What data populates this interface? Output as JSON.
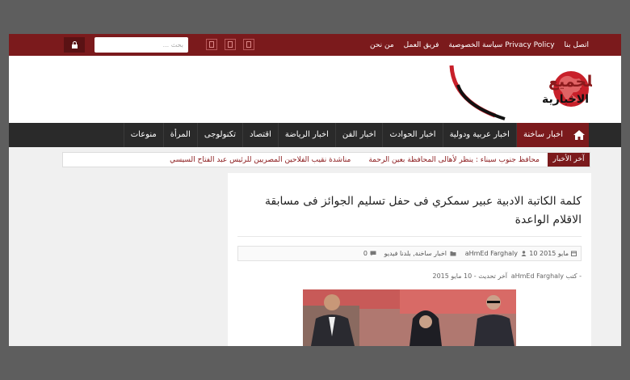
{
  "topbar": {
    "links": [
      "اتصل بنا",
      "سياسة الخصوصية Privacy Policy",
      "فريق العمل",
      "من نحن"
    ],
    "search_placeholder": "بحث ...",
    "social_icons": [
      "social-icon",
      "social-icon",
      "social-icon"
    ],
    "lock_icon": "lock-icon"
  },
  "logo": {
    "line1": "بلدنا للجميع",
    "line2": "الاخبارية"
  },
  "nav": {
    "home_icon": "home-icon",
    "items": [
      "اخبار ساخنة",
      "اخبار عربية ودولية",
      "اخبار الحوادث",
      "اخبار الفن",
      "اخبار الرياضة",
      "اقتصاد",
      "تكنولوجى",
      "المرأة",
      "منوعات"
    ]
  },
  "ticker": {
    "label": "آخر الأخبار",
    "items": [
      "محافظ جنوب سيناء : ينظر لأهالى المحافظة بعين الرحمة",
      "مناشدة نقيب الفلاحين المصريين للرئيس عبد الفتاح السيسي"
    ]
  },
  "article": {
    "title": "كلمة الكاتبة الادبية عبير سمكري فى حفل تسليم الجوائز فى مسابقة الاقلام الواعدة",
    "date": "10 مايو 2015",
    "author": "aHmEd Farghaly",
    "categories": "اخبار ساخنة, بلدنا فيديو",
    "comments": "0",
    "byline_prefix": "كتب -",
    "byline_author": "aHmEd Farghaly",
    "last_update": "آخر تحديث - 10 مايو 2015"
  },
  "colors": {
    "brand": "#7b1a1c",
    "nav_bg": "#2a2a2a",
    "page_bg": "#f0f0f0"
  }
}
